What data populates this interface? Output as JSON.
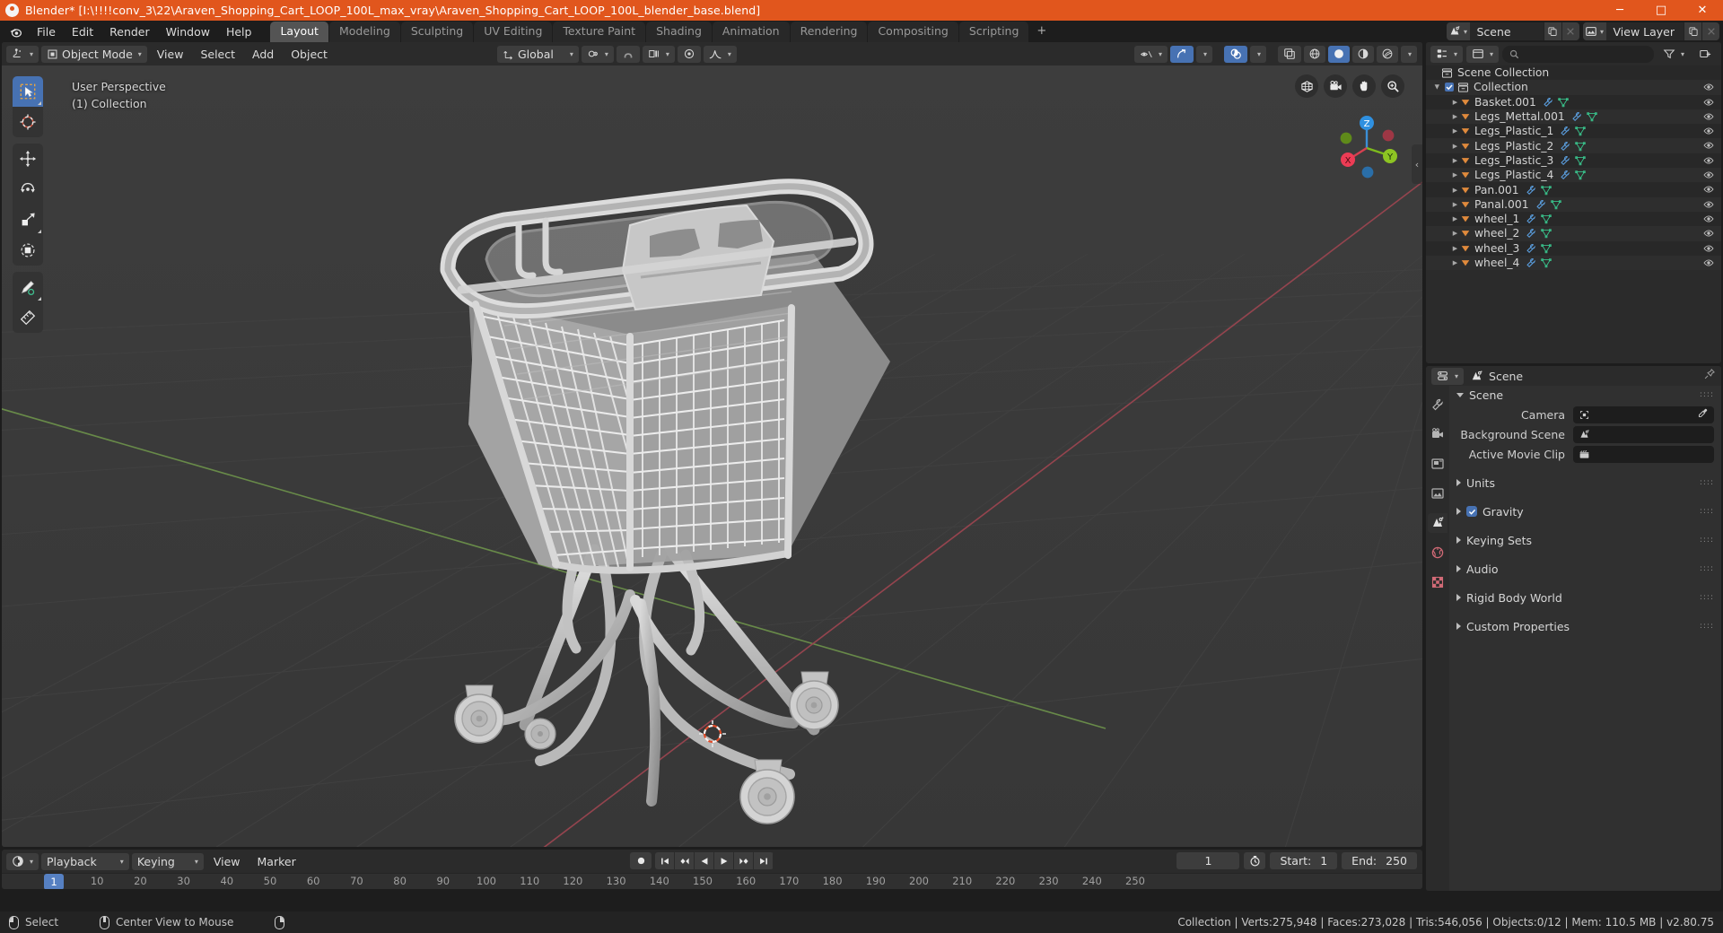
{
  "window": {
    "title": "Blender* [I:\\!!!!conv_3\\22\\Araven_Shopping_Cart_LOOP_100L_max_vray\\Araven_Shopping_Cart_LOOP_100L_blender_base.blend]",
    "minimize": "─",
    "maximize": "□",
    "close": "✕"
  },
  "menubar": {
    "items": [
      "File",
      "Edit",
      "Render",
      "Window",
      "Help"
    ],
    "workspaces": [
      {
        "label": "Layout",
        "active": true
      },
      {
        "label": "Modeling",
        "active": false
      },
      {
        "label": "Sculpting",
        "active": false
      },
      {
        "label": "UV Editing",
        "active": false
      },
      {
        "label": "Texture Paint",
        "active": false
      },
      {
        "label": "Shading",
        "active": false
      },
      {
        "label": "Animation",
        "active": false
      },
      {
        "label": "Rendering",
        "active": false
      },
      {
        "label": "Compositing",
        "active": false
      },
      {
        "label": "Scripting",
        "active": false
      }
    ],
    "add_workspace": "+",
    "scene_name": "Scene",
    "view_layer_name": "View Layer"
  },
  "viewport_header": {
    "editor_type": "editor-type-3dview",
    "mode": "Object Mode",
    "menus": [
      "View",
      "Select",
      "Add",
      "Object"
    ],
    "transform_orientation": "Global",
    "snap_icon": "magnet-icon",
    "proportional_icon": "proportional-edit-icon"
  },
  "viewport": {
    "perspective_label": "User Perspective",
    "collection_label": "(1) Collection",
    "gizmo_axes": [
      "X",
      "Y",
      "Z"
    ],
    "toolbar_tools": [
      "select-box-tool",
      "cursor-tool",
      "move-tool",
      "rotate-tool",
      "scale-tool",
      "transform-tool",
      "annotate-tool",
      "measure-tool"
    ],
    "nav_buttons": [
      "toggle-orthographic-icon",
      "camera-view-icon",
      "pan-view-icon",
      "zoom-view-icon"
    ]
  },
  "outliner": {
    "header_icons": [
      "outliner-display-mode-icon",
      "outliner-filter-id-icon",
      "search-icon",
      "filter-icon",
      "new-collection-icon"
    ],
    "search_placeholder": "",
    "root": "Scene Collection",
    "collection": "Collection",
    "objects": [
      {
        "name": "Basket.001"
      },
      {
        "name": "Legs_Mettal.001"
      },
      {
        "name": "Legs_Plastic_1"
      },
      {
        "name": "Legs_Plastic_2"
      },
      {
        "name": "Legs_Plastic_3"
      },
      {
        "name": "Legs_Plastic_4"
      },
      {
        "name": "Pan.001"
      },
      {
        "name": "Panal.001"
      },
      {
        "name": "wheel_1"
      },
      {
        "name": "wheel_2"
      },
      {
        "name": "wheel_3"
      },
      {
        "name": "wheel_4"
      }
    ]
  },
  "properties": {
    "breadcrumb": "Scene",
    "tabs": [
      "tool-tab",
      "render-tab",
      "output-tab",
      "view-layer-tab",
      "scene-tab",
      "world-tab",
      "texture-tab"
    ],
    "panels": [
      {
        "label": "Scene",
        "open": true
      },
      {
        "label": "Units",
        "open": false
      },
      {
        "label": "Gravity",
        "open": false,
        "checkbox": true
      },
      {
        "label": "Keying Sets",
        "open": false
      },
      {
        "label": "Audio",
        "open": false
      },
      {
        "label": "Rigid Body World",
        "open": false
      },
      {
        "label": "Custom Properties",
        "open": false
      }
    ],
    "fields": [
      {
        "label": "Camera",
        "value": "",
        "icon": "camera-data-icon",
        "eyedropper": true
      },
      {
        "label": "Background Scene",
        "value": "",
        "icon": "scene-data-icon",
        "eyedropper": false
      },
      {
        "label": "Active Movie Clip",
        "value": "",
        "icon": "movie-clip-icon",
        "eyedropper": false
      }
    ]
  },
  "timeline": {
    "editor_type": "editor-type-timeline",
    "menus": [
      "Playback",
      "Keying",
      "View",
      "Marker"
    ],
    "transport": [
      "record-icon",
      "jump-to-start-icon",
      "prev-keyframe-icon",
      "play-reverse-icon",
      "play-icon",
      "next-keyframe-icon",
      "jump-to-end-icon"
    ],
    "current_frame": "1",
    "use_preview_range_icon": "stopwatch-icon",
    "start_label": "Start:",
    "start_value": "1",
    "end_label": "End:",
    "end_value": "250",
    "ticks": [
      "10",
      "20",
      "30",
      "40",
      "50",
      "60",
      "70",
      "80",
      "90",
      "100",
      "110",
      "120",
      "130",
      "140",
      "150",
      "160",
      "170",
      "180",
      "190",
      "200",
      "210",
      "220",
      "230",
      "240",
      "250"
    ],
    "playhead_label": "1"
  },
  "statusbar": {
    "left_mouse_action": "Select",
    "middle_mouse_action": "Center View to Mouse",
    "stats": "Collection | Verts:275,948 | Faces:273,028 | Tris:546,056 | Objects:0/12 | Mem: 110.5 MB | v2.80.75"
  },
  "colors": {
    "accent_orange": "#e1561d",
    "accent_blue": "#4772b3",
    "panel_bg": "#2b2b2b",
    "viewport_bg": "#393939",
    "object_orange": "#e08a3c",
    "mesh_green": "#39c08a",
    "modifier_blue": "#5b9fe0"
  }
}
